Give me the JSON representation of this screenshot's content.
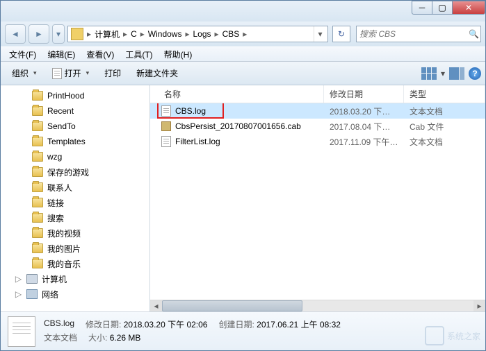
{
  "breadcrumb": [
    "计算机",
    "C",
    "Windows",
    "Logs",
    "CBS"
  ],
  "search_placeholder": "搜索 CBS",
  "menus": {
    "file": "文件(F)",
    "edit": "编辑(E)",
    "view": "查看(V)",
    "tools": "工具(T)",
    "help": "帮助(H)"
  },
  "toolbar": {
    "organize": "组织",
    "open": "打开",
    "print": "打印",
    "newfolder": "新建文件夹"
  },
  "tree": [
    {
      "label": "PrintHood",
      "icon": "folder"
    },
    {
      "label": "Recent",
      "icon": "folder"
    },
    {
      "label": "SendTo",
      "icon": "folder"
    },
    {
      "label": "Templates",
      "icon": "folder"
    },
    {
      "label": "wzg",
      "icon": "folder"
    },
    {
      "label": "保存的游戏",
      "icon": "folder"
    },
    {
      "label": "联系人",
      "icon": "folder"
    },
    {
      "label": "链接",
      "icon": "folder"
    },
    {
      "label": "搜索",
      "icon": "folder"
    },
    {
      "label": "我的视频",
      "icon": "folder"
    },
    {
      "label": "我的图片",
      "icon": "folder"
    },
    {
      "label": "我的音乐",
      "icon": "folder"
    },
    {
      "label": "计算机",
      "icon": "computer",
      "expandable": true,
      "level": 2
    },
    {
      "label": "网络",
      "icon": "net",
      "expandable": true,
      "level": 2
    }
  ],
  "columns": {
    "name": "名称",
    "date": "修改日期",
    "type": "类型"
  },
  "files": [
    {
      "name": "CBS.log",
      "date": "2018.03.20 下午 ...",
      "type": "文本文档",
      "icon": "file",
      "selected": true,
      "highlight": true
    },
    {
      "name": "CbsPersist_20170807001656.cab",
      "date": "2017.08.04 下午 ...",
      "type": "Cab 文件",
      "icon": "cab"
    },
    {
      "name": "FilterList.log",
      "date": "2017.11.09 下午 ...",
      "type": "文本文档",
      "icon": "file"
    }
  ],
  "details": {
    "name": "CBS.log",
    "moddate_label": "修改日期:",
    "moddate": "2018.03.20 下午 02:06",
    "created_label": "创建日期:",
    "created": "2017.06.21 上午 08:32",
    "type": "文本文档",
    "size_label": "大小:",
    "size": "6.26 MB"
  },
  "watermark": "系统之家"
}
